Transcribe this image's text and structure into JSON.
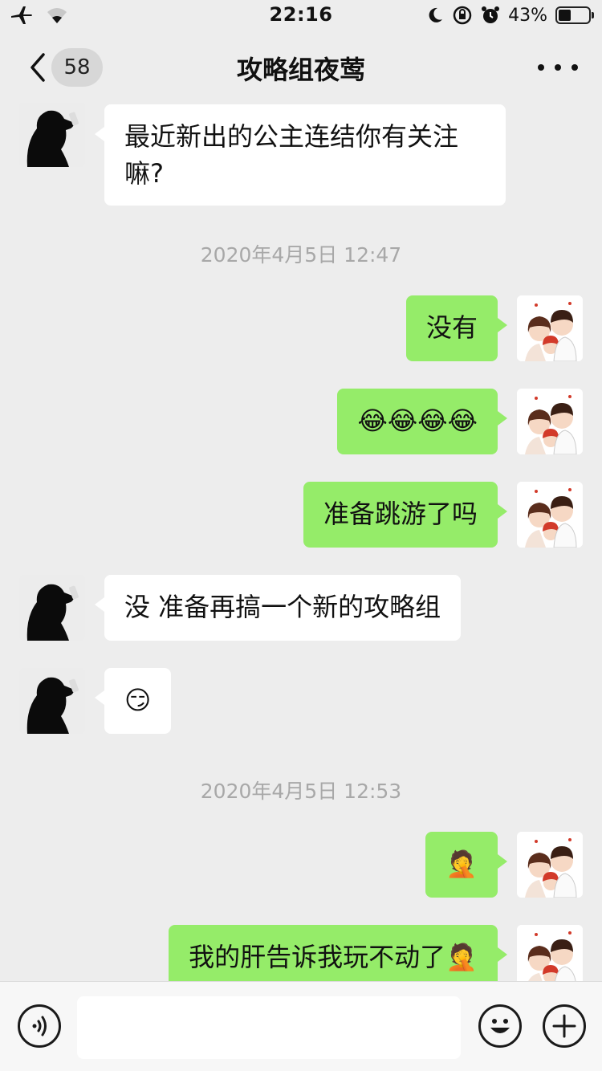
{
  "status_bar": {
    "time": "22:16",
    "battery_percent": "43%",
    "battery_level": 0.43,
    "icons": [
      "airplane-icon",
      "wifi-icon",
      "moon-icon",
      "orientation-lock-icon",
      "alarm-icon",
      "battery-icon"
    ]
  },
  "nav": {
    "back_icon": "chevron-left-icon",
    "unread_count": "58",
    "title": "攻略组夜莺",
    "more_icon": "more-dots-icon"
  },
  "messages": [
    {
      "side": "left",
      "text": "最近新出的公主连结你有关注",
      "text2": "嘛?"
    },
    {
      "type": "timestamp",
      "text": "2020年4月5日 12:47"
    },
    {
      "side": "right",
      "text": "没有"
    },
    {
      "side": "right",
      "text": "😂😂😂😂"
    },
    {
      "side": "right",
      "text": "准备跳游了吗"
    },
    {
      "side": "left",
      "text": "没 准备再搞一个新的攻略组"
    },
    {
      "side": "left",
      "text": "😏"
    },
    {
      "type": "timestamp",
      "text": "2020年4月5日 12:53"
    },
    {
      "side": "right",
      "text": "🤦"
    },
    {
      "side": "right",
      "text": "我的肝告诉我玩不动了🤦"
    }
  ],
  "input_bar": {
    "voice_icon": "voice-icon",
    "input_value": "",
    "emoji_icon": "emoji-icon",
    "plus_icon": "plus-icon"
  },
  "colors": {
    "background": "#ededed",
    "bubble_self": "#95ec69",
    "bubble_other": "#ffffff",
    "timestamp": "#a8a8a8"
  }
}
